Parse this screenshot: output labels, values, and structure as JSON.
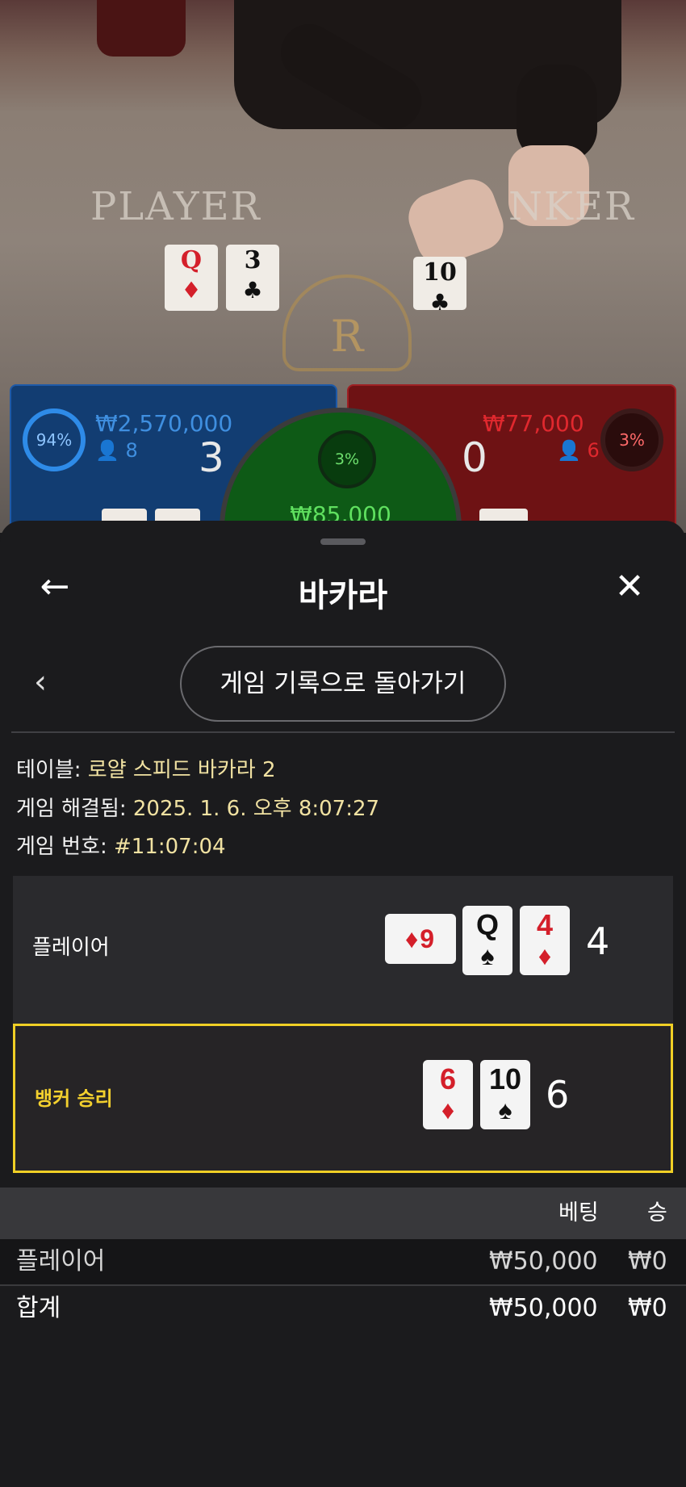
{
  "table_overlay": {
    "player_word": "PLAYER",
    "banker_word": "NKER",
    "logo_letter": "R",
    "player_cards": [
      {
        "rank": "Q",
        "suit": "♦"
      },
      {
        "rank": "3",
        "suit": "♣"
      }
    ],
    "banker_cards": [
      {
        "rank": "10",
        "suit": "♣"
      }
    ]
  },
  "stats": {
    "player": {
      "percent": "94%",
      "amount": "₩2,570,000",
      "bettors": "8",
      "score": "3"
    },
    "tie": {
      "percent": "3%",
      "amount": "₩85,000"
    },
    "banker": {
      "percent": "3%",
      "amount": "₩77,000",
      "bettors": "6",
      "score": "0"
    }
  },
  "sheet": {
    "title": "바카라",
    "back_icon": "arrow-left-icon",
    "close_icon": "close-icon",
    "prev_icon": "chevron-left-icon",
    "history_button": "게임 기록으로 돌아가기",
    "info": {
      "table_label": "테이블:",
      "table_value": "로얄 스피드 바카라 2",
      "resolved_label": "게임 해결됨:",
      "resolved_value": "2025. 1. 6. 오후 8:07:27",
      "game_label": "게임 번호:",
      "game_value": "#11:07:04"
    },
    "player_hand": {
      "label": "플레이어",
      "cards": [
        {
          "rank": "9",
          "suit": "♦"
        },
        {
          "rank": "Q",
          "suit": "♠"
        },
        {
          "rank": "4",
          "suit": "♦"
        }
      ],
      "total": "4"
    },
    "banker_hand": {
      "label": "뱅커 승리",
      "cards": [
        {
          "rank": "6",
          "suit": "♦"
        },
        {
          "rank": "10",
          "suit": "♠"
        }
      ],
      "total": "6"
    },
    "bets_table": {
      "headers": [
        "베팅",
        "승"
      ],
      "rows": [
        {
          "name": "플레이어",
          "bet": "₩50,000",
          "win": "₩0"
        }
      ],
      "total": {
        "name": "합계",
        "bet": "₩50,000",
        "win": "₩0"
      }
    }
  },
  "colors": {
    "player_blue": "#123d72",
    "banker_red": "#6e1214",
    "tie_green": "#0e5a16",
    "win_highlight": "#f0cf25",
    "info_value": "#f1e2a2"
  }
}
